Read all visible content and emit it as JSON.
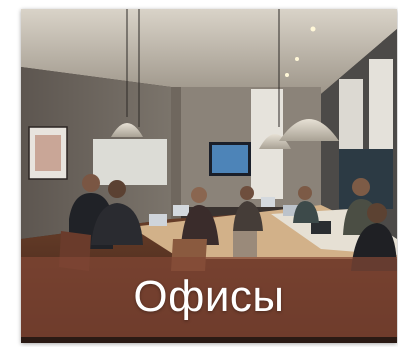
{
  "caption": {
    "text": "Офисы"
  },
  "colors": {
    "overlay": "#824634",
    "caption_text": "#ffffff",
    "background": "#ffffff"
  }
}
